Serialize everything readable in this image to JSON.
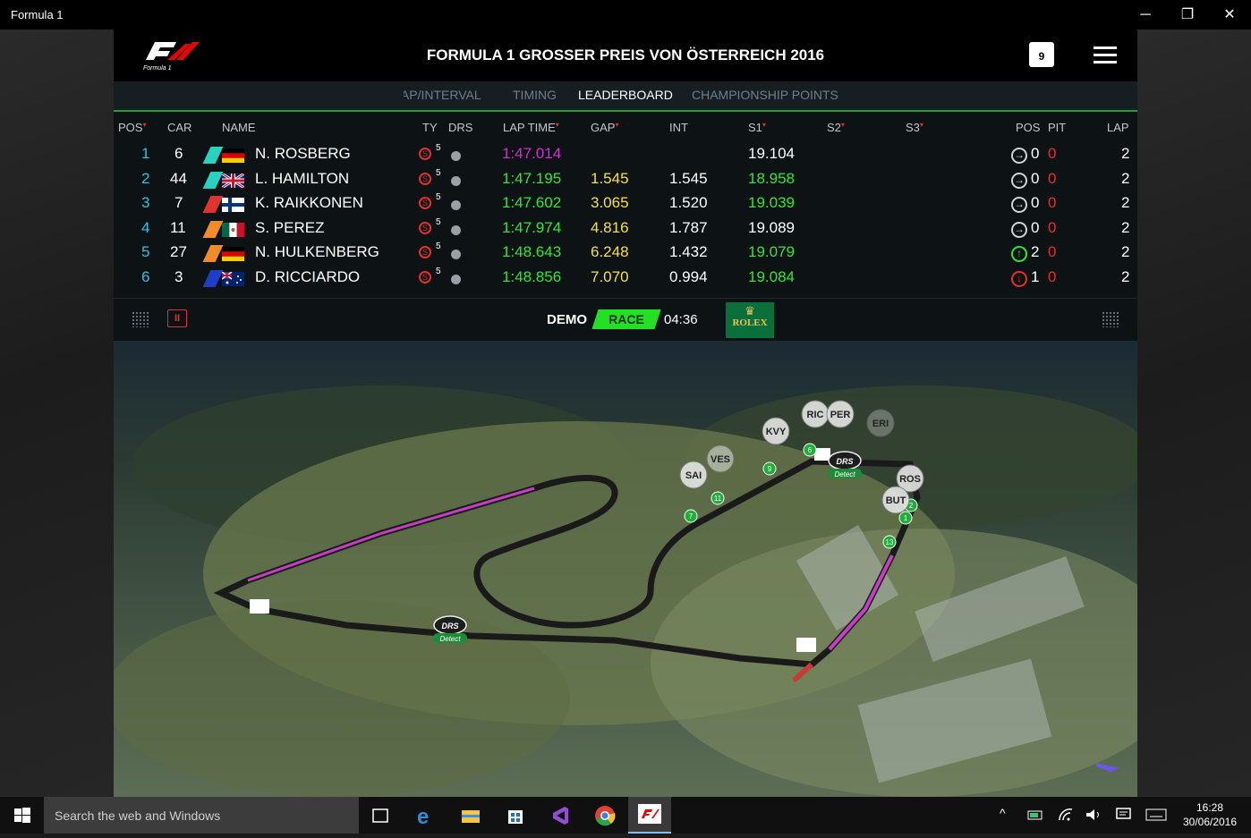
{
  "window": {
    "title": "Formula 1",
    "controls": {
      "minimize": "─",
      "restore": "❐",
      "close": "✕"
    }
  },
  "header": {
    "event_title": "FORMULA 1 GROSSER PREIS VON ÖSTERREICH 2016",
    "calendar_day": "9",
    "logo_word": "Formula 1"
  },
  "tabs": [
    {
      "label": "GAP/INTERVAL",
      "active": false
    },
    {
      "label": "TIMING",
      "active": false
    },
    {
      "label": "LEADERBOARD",
      "active": true
    },
    {
      "label": "CHAMPIONSHIP POINTS",
      "active": false
    }
  ],
  "leaderboard": {
    "columns": {
      "pos": "POS",
      "car": "CAR",
      "name": "NAME",
      "ty": "TY",
      "drs": "DRS",
      "lap_time": "LAP TIME",
      "gap": "GAP",
      "int": "INT",
      "s1": "S1",
      "s2": "S2",
      "s3": "S3",
      "pos_change": "POS",
      "pit": "PIT",
      "lap": "LAP"
    },
    "rows": [
      {
        "pos": "1",
        "car": "6",
        "name": "N. ROSBERG",
        "team_color": "#27d3c0",
        "flag": "de",
        "tyre": "S",
        "tyre_age": "5",
        "lap_time": "1:47.014",
        "lap_time_color": "#d12fd1",
        "gap": "",
        "int": "",
        "s1": "19.104",
        "s1_color": "#ffffff",
        "pos_arrow": "→",
        "pos_arrow_color": "#cfd4d7",
        "pos_change": "0",
        "pit": "0",
        "lap": "2"
      },
      {
        "pos": "2",
        "car": "44",
        "name": "L. HAMILTON",
        "team_color": "#27d3c0",
        "flag": "gb",
        "tyre": "S",
        "tyre_age": "5",
        "lap_time": "1:47.195",
        "lap_time_color": "#2ee82e",
        "gap": "1.545",
        "int": "1.545",
        "s1": "18.958",
        "s1_color": "#2ee82e",
        "pos_arrow": "→",
        "pos_arrow_color": "#cfd4d7",
        "pos_change": "0",
        "pit": "0",
        "lap": "2"
      },
      {
        "pos": "3",
        "car": "7",
        "name": "K. RAIKKONEN",
        "team_color": "#e0322e",
        "flag": "fi",
        "tyre": "S",
        "tyre_age": "5",
        "lap_time": "1:47.602",
        "lap_time_color": "#2ee82e",
        "gap": "3.065",
        "int": "1.520",
        "s1": "19.039",
        "s1_color": "#2ee82e",
        "pos_arrow": "→",
        "pos_arrow_color": "#cfd4d7",
        "pos_change": "0",
        "pit": "0",
        "lap": "2"
      },
      {
        "pos": "4",
        "car": "11",
        "name": "S. PEREZ",
        "team_color": "#f28c28",
        "flag": "mx",
        "tyre": "S",
        "tyre_age": "5",
        "lap_time": "1:47.974",
        "lap_time_color": "#2ee82e",
        "gap": "4.816",
        "int": "1.787",
        "s1": "19.089",
        "s1_color": "#ffffff",
        "pos_arrow": "→",
        "pos_arrow_color": "#cfd4d7",
        "pos_change": "0",
        "pit": "0",
        "lap": "2"
      },
      {
        "pos": "5",
        "car": "27",
        "name": "N. HULKENBERG",
        "team_color": "#f28c28",
        "flag": "de",
        "tyre": "S",
        "tyre_age": "5",
        "lap_time": "1:48.643",
        "lap_time_color": "#2ee82e",
        "gap": "6.248",
        "int": "1.432",
        "s1": "19.079",
        "s1_color": "#2ee82e",
        "pos_arrow": "↑",
        "pos_arrow_color": "#2ee82e",
        "pos_change": "2",
        "pit": "0",
        "lap": "2"
      },
      {
        "pos": "6",
        "car": "3",
        "name": "D. RICCIARDO",
        "team_color": "#1e3ec8",
        "flag": "au",
        "tyre": "S",
        "tyre_age": "5",
        "lap_time": "1:48.856",
        "lap_time_color": "#2ee82e",
        "gap": "7.070",
        "int": "0.994",
        "s1": "19.084",
        "s1_color": "#2ee82e",
        "pos_arrow": "↓",
        "pos_arrow_color": "#e0322e",
        "pos_change": "1",
        "pit": "0",
        "lap": "2"
      }
    ]
  },
  "controls": {
    "pause": "II",
    "mode": "DEMO",
    "session": "RACE",
    "clock": "04:36",
    "sponsor": "ROLEX"
  },
  "map": {
    "drivers": [
      {
        "label": "RIC"
      },
      {
        "label": "PER"
      },
      {
        "label": "ERI"
      },
      {
        "label": "KVY"
      },
      {
        "label": "VES"
      },
      {
        "label": "SAI"
      },
      {
        "label": "ROS"
      },
      {
        "label": "BUT"
      }
    ],
    "drs_labels": [
      "DRS",
      "Detect"
    ],
    "corners": [
      "9",
      "7",
      "11",
      "1",
      "2",
      "13",
      "6"
    ]
  },
  "taskbar": {
    "search_placeholder": "Search the web and Windows",
    "time": "16:28",
    "date": "30/06/2016",
    "tray_chevron": "^"
  }
}
